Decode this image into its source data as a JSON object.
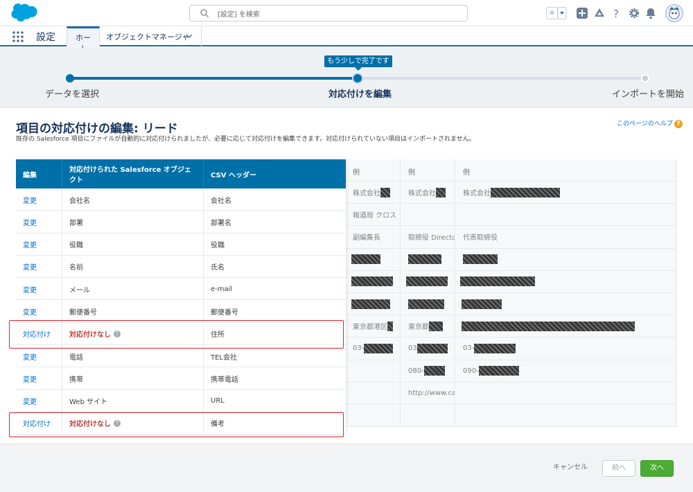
{
  "header": {
    "search_placeholder": "[設定] を検索",
    "icons": [
      "salesforce-cloud-logo",
      "favorites-star-icon",
      "add-icon",
      "trailhead-icon",
      "help-icon",
      "gear-icon",
      "bell-icon",
      "avatar"
    ]
  },
  "nav": {
    "app_name": "設定",
    "tabs": [
      {
        "label": "ホーム"
      },
      {
        "label": "オブジェクトマネージャ"
      }
    ]
  },
  "progress": {
    "tooltip": "もう少しで完了です",
    "steps": [
      {
        "label": "データを選択",
        "state": "done"
      },
      {
        "label": "対応付けを編集",
        "state": "current"
      },
      {
        "label": "インポートを開始",
        "state": "todo"
      }
    ]
  },
  "page": {
    "title": "項目の対応付けの編集: リード",
    "description": "既存の Salesforce 項目にファイルが自動的に対応付けられましたが、必要に応じて対応付けを編集できます。対応付けられていない項目はインポートされません。",
    "help_link": "このページのヘルプ"
  },
  "mapping": {
    "headers": {
      "edit": "編集",
      "object": "対応付けられた Salesforce オブジェクト",
      "csv": "CSV ヘッダー"
    },
    "rows": [
      {
        "action": "変更",
        "field": "会社名",
        "csv": "会社名",
        "unmapped": false
      },
      {
        "action": "変更",
        "field": "部署",
        "csv": "部署名",
        "unmapped": false
      },
      {
        "action": "変更",
        "field": "役職",
        "csv": "役職",
        "unmapped": false
      },
      {
        "action": "変更",
        "field": "名前",
        "csv": "氏名",
        "unmapped": false
      },
      {
        "action": "変更",
        "field": "メール",
        "csv": "e-mail",
        "unmapped": false
      },
      {
        "action": "変更",
        "field": "郵便番号",
        "csv": "郵便番号",
        "unmapped": false
      },
      {
        "action": "対応付け",
        "field": "対応付けなし",
        "csv": "住所",
        "unmapped": true
      },
      {
        "action": "変更",
        "field": "電話",
        "csv": "TEL会社",
        "unmapped": false
      },
      {
        "action": "変更",
        "field": "携帯",
        "csv": "携帯電話",
        "unmapped": false
      },
      {
        "action": "変更",
        "field": "Web サイト",
        "csv": "URL",
        "unmapped": false
      },
      {
        "action": "対応付け",
        "field": "対応付けなし",
        "csv": "備考",
        "unmapped": true
      }
    ]
  },
  "samples": [
    {
      "header": "例",
      "cells": [
        "株式会社",
        "報道局 クロス",
        "副編集長",
        "",
        "",
        "",
        "東京都港区",
        "03-",
        "",
        "",
        ""
      ]
    },
    {
      "header": "例",
      "cells": [
        "株式会社",
        "",
        "取締役 Directo",
        "",
        "",
        "",
        "東京都",
        "03",
        "080-",
        "http://www.ca-",
        ""
      ]
    },
    {
      "header": "例",
      "cells": [
        "株式会社",
        "",
        "代表取締役",
        "",
        "",
        "",
        "",
        "03-",
        "090-",
        "",
        ""
      ]
    }
  ],
  "footer": {
    "cancel": "キャンセル",
    "prev": "前へ",
    "next": "次へ"
  },
  "colors": {
    "brand": "#0070a8",
    "next_button": "#4bab32",
    "unmapped": "#c23934",
    "highlight_box": "#d9232a"
  }
}
